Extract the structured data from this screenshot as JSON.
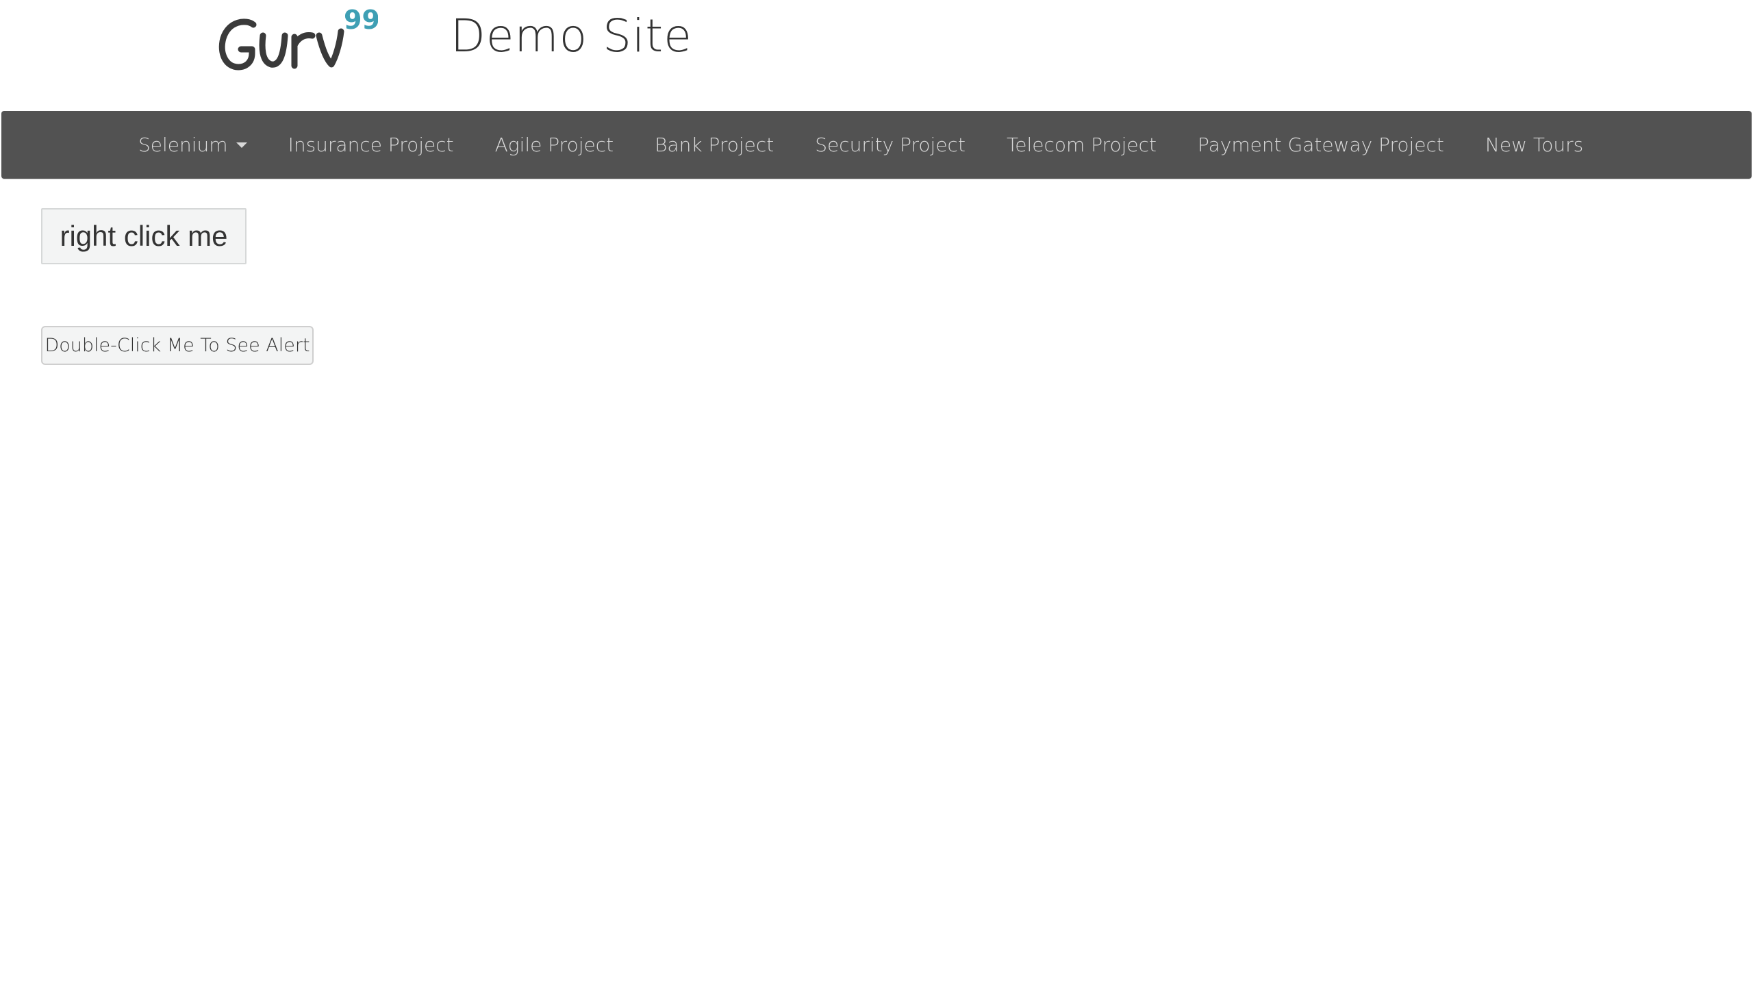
{
  "header": {
    "logo_text": "GURU",
    "logo_superscript": "99",
    "site_title": "Demo Site"
  },
  "nav": {
    "items": [
      {
        "label": "Selenium",
        "has_dropdown": true
      },
      {
        "label": "Insurance Project"
      },
      {
        "label": "Agile Project"
      },
      {
        "label": "Bank Project"
      },
      {
        "label": "Security Project"
      },
      {
        "label": "Telecom Project"
      },
      {
        "label": "Payment Gateway Project"
      },
      {
        "label": "New Tours"
      }
    ]
  },
  "main": {
    "right_click_label": "right click me",
    "double_click_label": "Double-Click Me To See Alert"
  },
  "colors": {
    "navbar_bg": "#525252",
    "nav_text": "#d9d9d9",
    "logo_dark": "#3a3a3a",
    "logo_accent": "#3e9fb4"
  }
}
